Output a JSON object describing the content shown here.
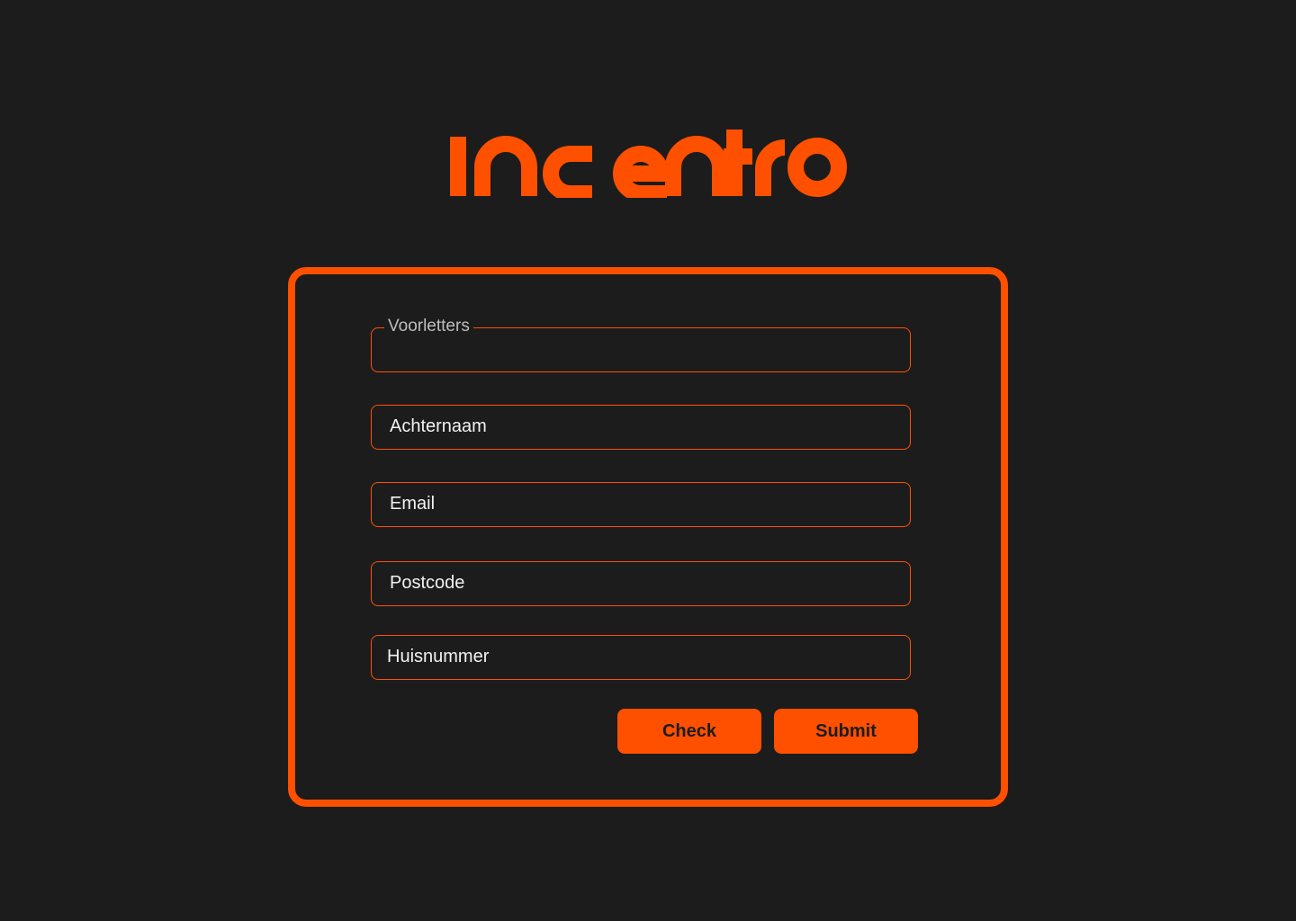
{
  "brand": {
    "logo_text": "incentro",
    "accent_color": "#ff5000",
    "background_color": "#1c1c1c"
  },
  "form": {
    "initials": {
      "label": "Voorletters",
      "value": ""
    },
    "last_name": {
      "placeholder": "Achternaam"
    },
    "email": {
      "placeholder": "Email"
    },
    "postcode": {
      "placeholder": "Postcode"
    },
    "house_number": {
      "placeholder": "Huisnummer"
    },
    "buttons": {
      "check_label": "Check",
      "submit_label": "Submit"
    }
  }
}
